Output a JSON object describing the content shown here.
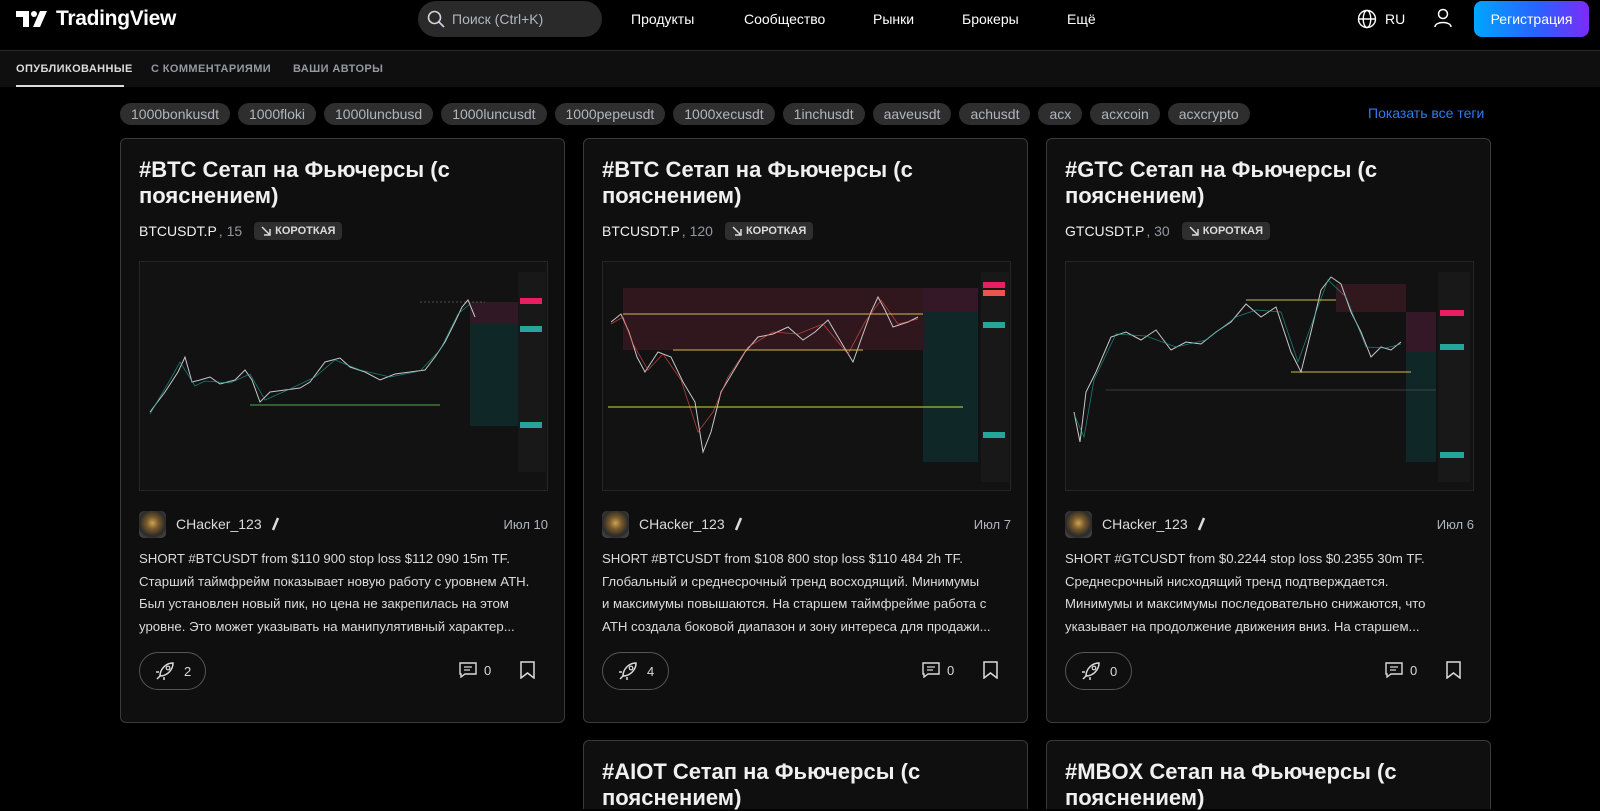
{
  "brand": {
    "name": "TradingView"
  },
  "search": {
    "placeholder": "Поиск (Ctrl+K)"
  },
  "nav": {
    "items": [
      "Продукты",
      "Сообщество",
      "Рынки",
      "Брокеры",
      "Ещё"
    ]
  },
  "lang": {
    "label": "RU"
  },
  "register": {
    "label": "Регистрация"
  },
  "subtabs": [
    "ОПУБЛИКОВАННЫЕ",
    "С КОММЕНТАРИЯМИ",
    "ВАШИ АВТОРЫ"
  ],
  "tags": [
    "1000bonkusdt",
    "1000floki",
    "1000luncbusd",
    "1000luncusdt",
    "1000pepeusdt",
    "1000xecusdt",
    "1inchusdt",
    "aaveusdt",
    "achusdt",
    "acx",
    "acxcoin",
    "acxcrypto"
  ],
  "show_all": "Показать все теги",
  "colors": {
    "accent": "#2962ff",
    "link": "#3179f5",
    "background": "#000000",
    "card": "#0f0f0f"
  },
  "cards": [
    {
      "title": "#BTC Сетап на Фьючерсы (с пояснением)",
      "symbol": "BTCUSDT.P",
      "timeframe": ", 15",
      "direction": "КОРОТКАЯ",
      "author": "CHacker_123",
      "date": "Июл 10",
      "desc": [
        "SHORT #BTCUSDT from $110 900 stop loss $112 090 15m TF.",
        "Старший таймфрейм показывает новую работу с уровнем ATH.",
        "Был установлен новый пик, но цена не закрепилась на этом",
        "уровне. Это может указывать на манипулятивный характер..."
      ],
      "boosts": "2",
      "comments": "0"
    },
    {
      "title": "#BTC Сетап на Фьючерсы (с пояснением)",
      "symbol": "BTCUSDT.P",
      "timeframe": ", 120",
      "direction": "КОРОТКАЯ",
      "author": "CHacker_123",
      "date": "Июл 7",
      "desc": [
        "SHORT #BTCUSDT from $108 800 stop loss $110 484 2h TF.",
        "Глобальный и среднесрочный тренд восходящий. Минимумы",
        "и максимумы повышаются. На старшем таймфрейме работа с",
        "ATH создала боковой диапазон и зону интереса для продажи..."
      ],
      "boosts": "4",
      "comments": "0"
    },
    {
      "title": "#GTC Сетап на Фьючерсы (с пояснением)",
      "symbol": "GTCUSDT.P",
      "timeframe": ", 30",
      "direction": "КОРОТКАЯ",
      "author": "CHacker_123",
      "date": "Июл 6",
      "desc": [
        "SHORT #GTCUSDT from $0.2244 stop loss $0.2355 30m TF.",
        "Среднесрочный нисходящий тренд подтверждается.",
        "Минимумы и максимумы последовательно снижаются, что",
        "указывает на продолжение движения вниз. На старшем..."
      ],
      "boosts": "0",
      "comments": "0"
    },
    {
      "title": "#AIOT Сетап на Фьючерсы (с пояснением)"
    },
    {
      "title": "#MBOX Сетап на Фьючерсы (с пояснением)"
    }
  ]
}
